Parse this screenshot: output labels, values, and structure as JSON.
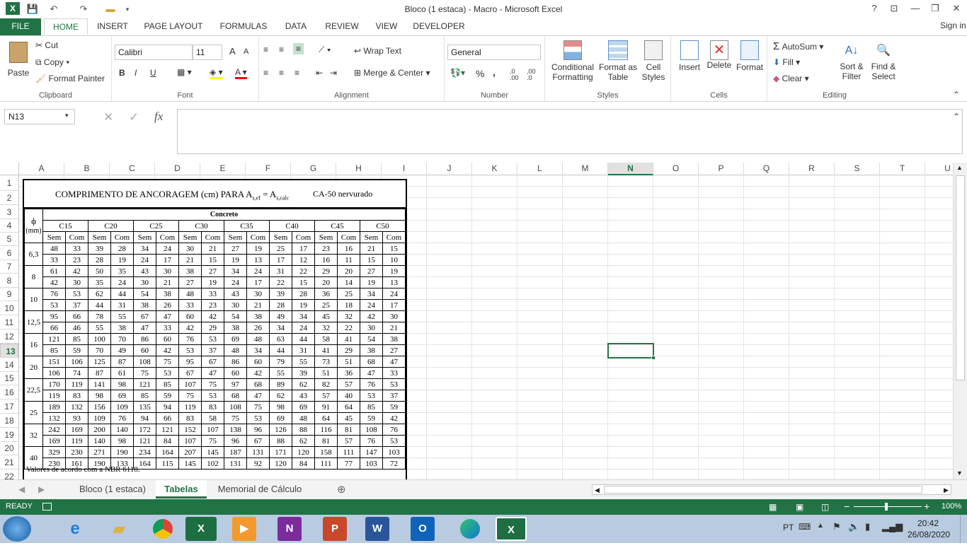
{
  "window": {
    "title": "Bloco (1 estaca) - Macro - Microsoft Excel",
    "signin": "Sign in",
    "help": "?"
  },
  "tabs": [
    "FILE",
    "HOME",
    "INSERT",
    "PAGE LAYOUT",
    "FORMULAS",
    "DATA",
    "REVIEW",
    "VIEW",
    "DEVELOPER"
  ],
  "ribbon": {
    "clipboard": {
      "label": "Clipboard",
      "paste": "Paste",
      "cut": "Cut",
      "copy": "Copy",
      "format_painter": "Format Painter"
    },
    "font": {
      "label": "Font",
      "name": "Calibri",
      "size": "11",
      "bold": "B",
      "italic": "I",
      "underline": "U",
      "grow": "A",
      "shrink": "A"
    },
    "alignment": {
      "label": "Alignment",
      "wrap": "Wrap Text",
      "merge": "Merge & Center"
    },
    "number": {
      "label": "Number",
      "format": "General",
      "percent": "%",
      "comma": ",",
      "inc": ",0 .00",
      "dec": ",00 .0"
    },
    "styles": {
      "label": "Styles",
      "conditional": "Conditional",
      "conditional2": "Formatting",
      "format_as": "Format as",
      "format_as2": "Table",
      "cell": "Cell",
      "cell2": "Styles"
    },
    "cells": {
      "label": "Cells",
      "insert": "Insert",
      "delete": "Delete",
      "format": "Format"
    },
    "editing": {
      "label": "Editing",
      "autosum": "AutoSum",
      "fill": "Fill",
      "clear": "Clear",
      "sort": "Sort &",
      "sort2": "Filter",
      "find": "Find &",
      "find2": "Select"
    }
  },
  "formula_bar": {
    "name_box": "N13",
    "fx": "fx",
    "content": ""
  },
  "columns": [
    "A",
    "B",
    "C",
    "D",
    "E",
    "F",
    "G",
    "H",
    "I",
    "J",
    "K",
    "L",
    "M",
    "N",
    "O",
    "P",
    "Q",
    "R",
    "S",
    "T",
    "U"
  ],
  "rows": [
    "1",
    "2",
    "3",
    "4",
    "5",
    "6",
    "7",
    "8",
    "9",
    "10",
    "11",
    "12",
    "13",
    "14",
    "15",
    "16",
    "17",
    "18",
    "19",
    "20",
    "21",
    "22"
  ],
  "selected": {
    "col": "N",
    "row": "13"
  },
  "table": {
    "title": "COMPRIMENTO DE ANCORAGEM (cm) PARA",
    "title_a1": "A",
    "title_a1_sub": "s,ef",
    "title_eq": " = A",
    "title_a2_sub": "s,calc",
    "steel": "CA-50 nervurado",
    "phi": "ϕ",
    "mm": "(mm)",
    "concreto": "Concreto",
    "classes": [
      "C15",
      "C20",
      "C25",
      "C30",
      "C35",
      "C40",
      "C45",
      "C50"
    ],
    "sem": "Sem",
    "com": "Com",
    "diameters": [
      "6,3",
      "8",
      "10",
      "12,5",
      "16",
      "20",
      "22,5",
      "25",
      "32",
      "40"
    ],
    "values": [
      [
        48,
        33,
        39,
        28,
        34,
        24,
        30,
        21,
        27,
        19,
        25,
        17,
        23,
        16,
        21,
        15
      ],
      [
        33,
        23,
        28,
        19,
        24,
        17,
        21,
        15,
        19,
        13,
        17,
        12,
        16,
        11,
        15,
        10
      ],
      [
        61,
        42,
        50,
        35,
        43,
        30,
        38,
        27,
        34,
        24,
        31,
        22,
        29,
        20,
        27,
        19
      ],
      [
        42,
        30,
        35,
        24,
        30,
        21,
        27,
        19,
        24,
        17,
        22,
        15,
        20,
        14,
        19,
        13
      ],
      [
        76,
        53,
        62,
        44,
        54,
        38,
        48,
        33,
        43,
        30,
        39,
        28,
        36,
        25,
        34,
        24
      ],
      [
        53,
        37,
        44,
        31,
        38,
        26,
        33,
        23,
        30,
        21,
        28,
        19,
        25,
        18,
        24,
        17
      ],
      [
        95,
        66,
        78,
        55,
        67,
        47,
        60,
        42,
        54,
        38,
        49,
        34,
        45,
        32,
        42,
        30
      ],
      [
        66,
        46,
        55,
        38,
        47,
        33,
        42,
        29,
        38,
        26,
        34,
        24,
        32,
        22,
        30,
        21
      ],
      [
        121,
        85,
        100,
        70,
        86,
        60,
        76,
        53,
        69,
        48,
        63,
        44,
        58,
        41,
        54,
        38
      ],
      [
        85,
        59,
        70,
        49,
        60,
        42,
        53,
        37,
        48,
        34,
        44,
        31,
        41,
        29,
        38,
        27
      ],
      [
        151,
        106,
        125,
        87,
        108,
        75,
        95,
        67,
        86,
        60,
        79,
        55,
        73,
        51,
        68,
        47
      ],
      [
        106,
        74,
        87,
        61,
        75,
        53,
        67,
        47,
        60,
        42,
        55,
        39,
        51,
        36,
        47,
        33
      ],
      [
        170,
        119,
        141,
        98,
        121,
        85,
        107,
        75,
        97,
        68,
        89,
        62,
        82,
        57,
        76,
        53
      ],
      [
        119,
        83,
        98,
        69,
        85,
        59,
        75,
        53,
        68,
        47,
        62,
        43,
        57,
        40,
        53,
        37
      ],
      [
        189,
        132,
        156,
        109,
        135,
        94,
        119,
        83,
        108,
        75,
        98,
        69,
        91,
        64,
        85,
        59
      ],
      [
        132,
        93,
        109,
        76,
        94,
        66,
        83,
        58,
        75,
        53,
        69,
        48,
        64,
        45,
        59,
        42
      ],
      [
        242,
        169,
        200,
        140,
        172,
        121,
        152,
        107,
        138,
        96,
        126,
        88,
        116,
        81,
        108,
        76
      ],
      [
        169,
        119,
        140,
        98,
        121,
        84,
        107,
        75,
        96,
        67,
        88,
        62,
        81,
        57,
        76,
        53
      ],
      [
        329,
        230,
        271,
        190,
        234,
        164,
        207,
        145,
        187,
        131,
        171,
        120,
        158,
        111,
        147,
        103
      ],
      [
        230,
        161,
        190,
        133,
        164,
        115,
        145,
        102,
        131,
        92,
        120,
        84,
        111,
        77,
        103,
        72
      ]
    ],
    "footer": "Valores de acordo com a NBR 6118."
  },
  "sheets": [
    "Bloco (1 estaca)",
    "Tabelas",
    "Memorial de Cálculo"
  ],
  "active_sheet": "Tabelas",
  "status": {
    "ready": "READY",
    "zoom": "100%"
  },
  "taskbar": {
    "lang": "PT",
    "time": "20:42",
    "date": "26/08/2020"
  }
}
